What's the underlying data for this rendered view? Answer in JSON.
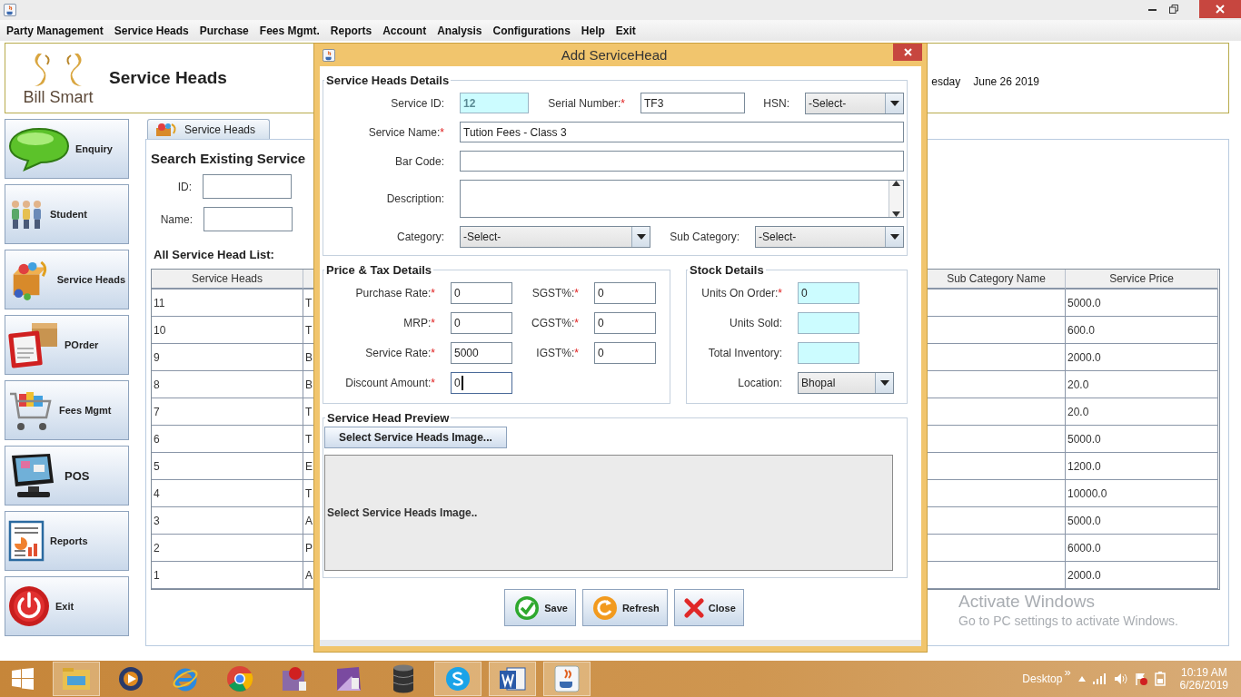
{
  "menu": [
    "Party Management",
    "Service Heads",
    "Purchase",
    "Fees Mgmt.",
    "Reports",
    "Account",
    "Analysis",
    "Configurations",
    "Help",
    "Exit"
  ],
  "header": {
    "logo_text": "Bill Smart",
    "title": "Service Heads",
    "day": "esday",
    "date": "June 26 2019"
  },
  "sidebar": [
    {
      "label": "Enquiry",
      "kind": "enquiry"
    },
    {
      "label": "Student",
      "kind": "student"
    },
    {
      "label": "Service Heads",
      "kind": "service_heads"
    },
    {
      "label": "POrder",
      "kind": "porder"
    },
    {
      "label": "Fees Mgmt",
      "kind": "fees"
    },
    {
      "label": "POS",
      "kind": "pos"
    },
    {
      "label": "Reports",
      "kind": "reports"
    },
    {
      "label": "Exit",
      "kind": "exit"
    }
  ],
  "tabs": [
    {
      "label": "Service Heads",
      "selected": true
    }
  ],
  "search": {
    "heading": "Search Existing Service",
    "fields": [
      {
        "label": "ID:"
      },
      {
        "label": "Name:"
      }
    ]
  },
  "list_heading": "All Service Head List:",
  "table": {
    "columns": [
      "Service Heads",
      "Sub Category Name",
      "Service Price"
    ],
    "rows": [
      {
        "service_heads": "11",
        "column_2": "T",
        "service_price": "5000.0"
      },
      {
        "service_heads": "10",
        "column_2": "T",
        "service_price": "600.0"
      },
      {
        "service_heads": "9",
        "column_2": "B",
        "service_price": "2000.0"
      },
      {
        "service_heads": "8",
        "column_2": "B",
        "service_price": "20.0"
      },
      {
        "service_heads": "7",
        "column_2": "T",
        "service_price": "20.0"
      },
      {
        "service_heads": "6",
        "column_2": "T",
        "service_price": "5000.0"
      },
      {
        "service_heads": "5",
        "column_2": "E",
        "service_price": "1200.0"
      },
      {
        "service_heads": "4",
        "column_2": "T",
        "service_price": "10000.0"
      },
      {
        "service_heads": "3",
        "column_2": "A",
        "service_price": "5000.0"
      },
      {
        "service_heads": "2",
        "column_2": "P",
        "service_price": "6000.0"
      },
      {
        "service_heads": "1",
        "column_2": "A",
        "service_price": "2000.0"
      }
    ]
  },
  "dialog": {
    "title": "Add ServiceHead",
    "details": {
      "legend": "Service Heads Details",
      "service_id": {
        "label": "Service ID:",
        "value": "12"
      },
      "serial_number": {
        "label": "Serial Number:",
        "required_mark": "*",
        "value": "TF3"
      },
      "hsn": {
        "label": "HSN:",
        "value": "-Select-"
      },
      "service_name": {
        "label": "Service Name:",
        "required_mark": "*",
        "value": "Tution Fees - Class 3"
      },
      "bar_code": {
        "label": "Bar Code:"
      },
      "description": {
        "label": "Description:"
      },
      "category": {
        "label": "Category:",
        "value": "-Select-"
      },
      "sub_category": {
        "label": "Sub Category:",
        "value": "-Select-"
      }
    },
    "price_tax": {
      "legend": "Price & Tax Details",
      "fields": [
        {
          "label": "Purchase Rate:",
          "required_mark": "*",
          "value": "0",
          "focused": false
        },
        {
          "label": "SGST%:",
          "required_mark": "*",
          "value": "0",
          "focused": false
        },
        {
          "label": "MRP:",
          "required_mark": "*",
          "value": "0",
          "focused": false
        },
        {
          "label": "CGST%:",
          "required_mark": "*",
          "value": "0",
          "focused": false
        },
        {
          "label": "Service Rate:",
          "required_mark": "*",
          "value": "5000",
          "focused": false
        },
        {
          "label": "IGST%:",
          "required_mark": "*",
          "value": "0",
          "focused": false
        },
        {
          "label": "Discount Amount:",
          "required_mark": "*",
          "value": "0",
          "focused": true
        }
      ]
    },
    "stock": {
      "legend": "Stock Details",
      "fields": [
        {
          "label": "Units On Order:",
          "required_mark": "*",
          "value": "0",
          "kind": "readonly"
        },
        {
          "label": "Units Sold:",
          "kind": "readonly"
        },
        {
          "label": "Total Inventory:",
          "kind": "readonly"
        },
        {
          "label": "Location:",
          "value": "Bhopal",
          "kind": "combo"
        }
      ]
    },
    "preview": {
      "legend": "Service Head Preview",
      "button": "Select Service Heads Image...",
      "placeholder_text": "Select Service Heads Image.."
    },
    "buttons": [
      {
        "label": "Save",
        "kind": "save"
      },
      {
        "label": "Refresh",
        "kind": "refresh"
      },
      {
        "label": "Close",
        "kind": "close"
      }
    ]
  },
  "activation_notice": {
    "title": "Activate Windows",
    "text": "Go to PC settings to activate Windows."
  },
  "taskbar": {
    "apps": [
      {
        "kind": "explorer",
        "running": true
      },
      {
        "kind": "media",
        "running": false
      },
      {
        "kind": "ie",
        "running": false
      },
      {
        "kind": "chrome",
        "running": false
      },
      {
        "kind": "app_red",
        "running": false
      },
      {
        "kind": "app_purple",
        "running": false
      },
      {
        "kind": "database",
        "running": false
      },
      {
        "kind": "skype",
        "running": true
      },
      {
        "kind": "word",
        "running": true
      },
      {
        "kind": "java",
        "running": true
      }
    ],
    "desktop_label": "Desktop",
    "overflow": "»",
    "time": "10:19 AM",
    "date": "6/26/2019"
  }
}
